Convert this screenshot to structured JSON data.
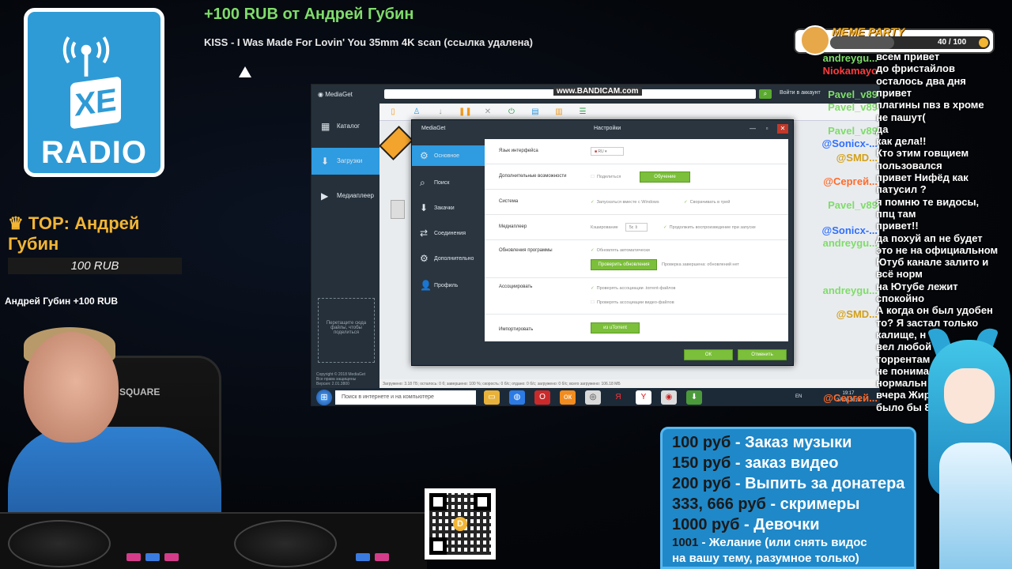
{
  "overlay": {
    "donation_title": "+100 RUB  от Андрей Губин",
    "track_title": "KISS - I Was Made For Lovin' You 35mm 4K scan (ссылка удалена)",
    "logo_text": "XE",
    "logo_radio": "RADIO",
    "top_donor_label": "♛ TOP: Андрей Губин",
    "top_donor_amount": "100 RUB",
    "alert_line": "Андрей Губин +100 RUB",
    "chair_brand": "SQUARE"
  },
  "meme_party": {
    "title": "MEME PARTY",
    "progress_text": "40 / 100",
    "progress": 0.4
  },
  "mediaget": {
    "app_name": "MediaGet",
    "bandicam": "www.BANDICAM.com",
    "login_text": "Войти в аккаунт",
    "sidebar": [
      {
        "icon": "catalog-icon",
        "glyph": "▦",
        "label": "Каталог"
      },
      {
        "icon": "download-icon",
        "glyph": "⬇",
        "label": "Загрузки",
        "active": true
      },
      {
        "icon": "mediaplayer-icon",
        "glyph": "▶",
        "label": "Медиаплеер"
      }
    ],
    "drop_zone": "Перетащите сюда файлы, чтобы поделиться",
    "version": "Copyright © 2018 MediaGet\nВсе права защищены\nВерсия: 2.01.3800",
    "status_bar": "Загружено: 3.18 ГБ; осталось: 0 б; завершено: 100 %; скорость: 0 б/с; отдано: 0 б/с; загружено: 0 б/с; всего загружено: 106.18 МБ"
  },
  "settings_dialog": {
    "app": "MediaGet",
    "title": "Настройки",
    "nav": [
      {
        "icon": "settings-icon",
        "glyph": "⚙",
        "label": "Основное",
        "active": true
      },
      {
        "icon": "search-icon",
        "glyph": "⌕",
        "label": "Поиск"
      },
      {
        "icon": "downloads-icon",
        "glyph": "⬇",
        "label": "Закачки"
      },
      {
        "icon": "connections-icon",
        "glyph": "⇄",
        "label": "Соединения"
      },
      {
        "icon": "advanced-icon",
        "glyph": "⚙",
        "label": "Дополнительно"
      },
      {
        "icon": "profile-icon",
        "glyph": "👤",
        "label": "Профиль"
      }
    ],
    "rows": {
      "language_label": "Язык интерфейса",
      "language_value": "RU",
      "extras_label": "Дополнительные возможности",
      "share_option": "Поделиться",
      "training_button": "Обучение",
      "system_label": "Система",
      "autostart_option": "Запускаться вместе с Windows",
      "tray_option": "Сворачивать в трей",
      "player_label": "Медиаплеер",
      "cache_label": "Кэширование",
      "cache_value": "5с",
      "resume_option": "Продолжить воспроизведение при запуске",
      "updates_label": "Обновления программы",
      "auto_update_option": "Обновлять автоматически",
      "check_update_button": "Проверить обновления",
      "update_status": "Проверка завершена: обновлений нет",
      "associate_label": "Ассоциировать",
      "torrent_assoc_option": "Проверять ассоциации .torrent-файлов",
      "video_assoc_option": "Проверять ассоциации видео-файлов",
      "import_label": "Импортировать",
      "utorrent_button": "из uTorrent"
    },
    "ok": "ОК",
    "cancel": "Отменить"
  },
  "taskbar": {
    "search_placeholder": "Поиск в интернете и на компьютере",
    "lang": "EN",
    "time": "19:17",
    "date": "27.08.2019"
  },
  "stream_names": [
    {
      "name": "andreygu...",
      "color": "#7fdc6a"
    },
    {
      "name": "Niokamayo",
      "color": "#ff3b3b"
    },
    {
      "name": "Pavel_v89",
      "color": "#7fdc6a"
    },
    {
      "name": "Pavel_v89",
      "color": "#7fdc6a"
    },
    {
      "name": "Pavel_v89",
      "color": "#7fdc6a"
    },
    {
      "name": "@Sonicx-...",
      "color": "#2f6fff"
    },
    {
      "name": "@SMD...",
      "color": "#d4a017"
    },
    {
      "name": "@Сергей...",
      "color": "#ff6b2b"
    },
    {
      "name": "Pavel_v89",
      "color": "#7fdc6a"
    },
    {
      "name": "@Sonicx-...",
      "color": "#2f6fff"
    },
    {
      "name": "andreygu...",
      "color": "#7fdc6a"
    },
    {
      "name": "andreygu...",
      "color": "#7fdc6a"
    },
    {
      "name": "@SMD...",
      "color": "#d4a017"
    },
    {
      "name": "@Сергей...",
      "color": "#ff6b2b"
    }
  ],
  "chat_messages": [
    "всем привет",
    "до фристайлов",
    "осталось два дня",
    "привет",
    "плагины пвз в хроме",
    "не пашут(",
    "да",
    "как дела!!",
    "Кто этим говщием",
    "пользовался",
    "привет Нифёд как",
    "патусил ?",
    "я помню те видосы,",
    "ппц там",
    "привет!!",
    "да похуй ап не будет",
    "это не на официальном",
    "Ютуб канале залито и",
    "всё норм",
    "на Ютубе лежит",
    "спокойно",
    "А когда он был удобен",
    "то? Я застал только",
    "калище, н",
    "вел любой",
    "торрентам",
    "не понима",
    "нормальн",
    "вчера Жир",
    "было бы 8"
  ],
  "prices": [
    {
      "price": "100 руб",
      "desc": "- Заказ музыки"
    },
    {
      "price": "150 руб",
      "desc": "- заказ видео"
    },
    {
      "price": "200 руб",
      "desc": "- Выпить за донатера"
    },
    {
      "price": "333, 666 руб",
      "desc": "- скримеры"
    },
    {
      "price": "1000 руб",
      "desc": "- Девочки"
    }
  ],
  "wish": {
    "price": "1001",
    "line1": " - Желание (или снять видос",
    "line2": "на вашу тему, разумное только)"
  },
  "qr_badge": "D"
}
